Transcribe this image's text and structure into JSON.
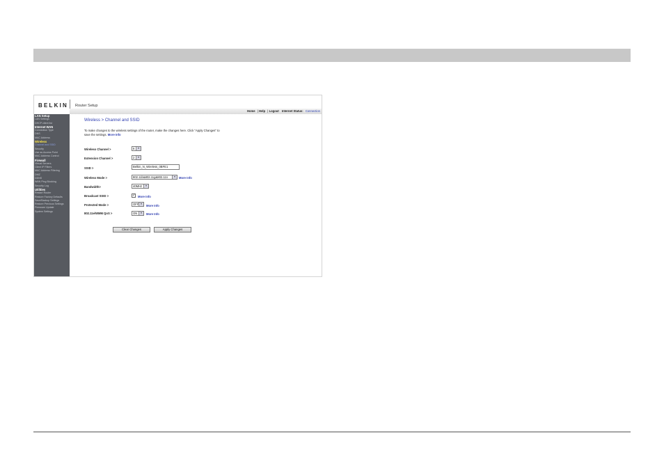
{
  "page": {
    "brand": "BELKIN",
    "app_title": "Router Setup"
  },
  "header_links": {
    "home": "Home",
    "sep1": "|",
    "help": "Help",
    "sep2": "|",
    "logout": "Logout",
    "status_label": "Internet Status:",
    "status_value": "Connection"
  },
  "sidebar": {
    "items": [
      {
        "label": "LAN Setup",
        "type": "section"
      },
      {
        "label": "LAN Settings",
        "type": "item"
      },
      {
        "label": "DHCP client list",
        "type": "item"
      },
      {
        "label": "Internet WAN",
        "type": "section"
      },
      {
        "label": "Connection Type",
        "type": "item"
      },
      {
        "label": "DNS",
        "type": "item"
      },
      {
        "label": "MAC Address",
        "type": "item"
      },
      {
        "label": "Wireless",
        "type": "active-section"
      },
      {
        "label": "Channel and SSID",
        "type": "active"
      },
      {
        "label": "Security",
        "type": "item"
      },
      {
        "label": "Use as Access Point",
        "type": "item"
      },
      {
        "label": "MAC Address Control",
        "type": "item"
      },
      {
        "label": "Firewall",
        "type": "section"
      },
      {
        "label": "Virtual Servers",
        "type": "item"
      },
      {
        "label": "Client IP Filters",
        "type": "item"
      },
      {
        "label": "MAC Address Filtering",
        "type": "item"
      },
      {
        "label": "DMZ",
        "type": "item"
      },
      {
        "label": "DDNS",
        "type": "item"
      },
      {
        "label": "WAN Ping Blocking",
        "type": "item"
      },
      {
        "label": "Security Log",
        "type": "item"
      },
      {
        "label": "Utilities",
        "type": "section"
      },
      {
        "label": "Restart Router",
        "type": "item"
      },
      {
        "label": "Restore Factory Defaults",
        "type": "item"
      },
      {
        "label": "Save/Backup Settings",
        "type": "item"
      },
      {
        "label": "Restore Previous Settings",
        "type": "item"
      },
      {
        "label": "Firmware Update",
        "type": "item"
      },
      {
        "label": "System Settings",
        "type": "item"
      }
    ]
  },
  "main": {
    "title": "Wireless > Channel and SSID",
    "intro": "To make changes to the wireless settings of the router, make the changes here. Click \"Apply Changes\" to save the settings.",
    "intro_more": "More Info",
    "fields": {
      "wireless_channel": {
        "label": "Wireless Channel >",
        "value": "6"
      },
      "extension_channel": {
        "label": "Extension Channel >",
        "value": "2"
      },
      "ssid": {
        "label": "SSID >",
        "value": "Belkin_N_Wireless_0BFE1"
      },
      "wireless_mode": {
        "label": "Wireless Mode >",
        "value": "802.11b&802.11g&802.11n",
        "more": "More Info"
      },
      "bandwidth": {
        "label": "Bandwidth>",
        "value": "40MHz"
      },
      "broadcast_ssid": {
        "label": "Broadcast SSID >",
        "checked": "✓",
        "more": "More Info"
      },
      "protected_mode": {
        "label": "Protected Mode >",
        "value": "OFF",
        "more": "More Info"
      },
      "wmm_qos": {
        "label": "802.11e/WMM QoS >",
        "value": "ON",
        "more": "More Info"
      }
    },
    "buttons": {
      "clear": "Clear Changes",
      "apply": "Apply Changes"
    },
    "arrow_glyph": "▾"
  }
}
